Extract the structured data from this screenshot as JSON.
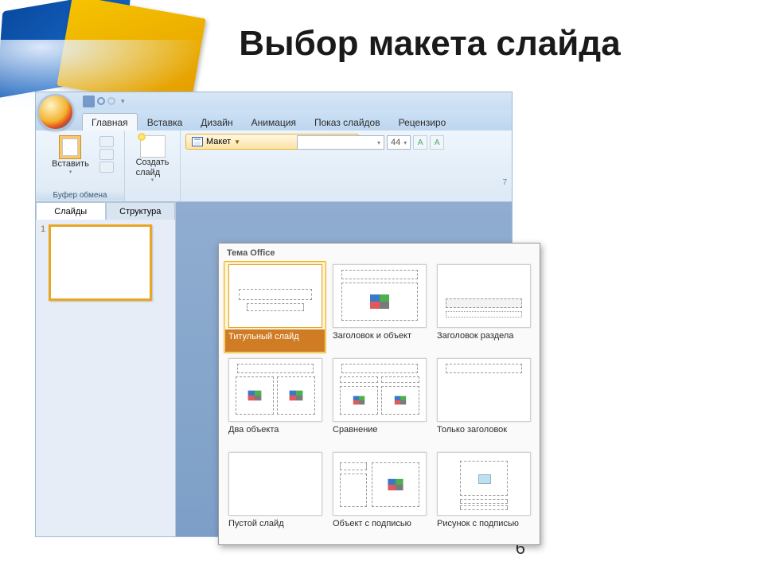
{
  "slide": {
    "title": "Выбор макета слайда",
    "page_number": "6"
  },
  "qat": {
    "save": "disk-icon",
    "undo": "undo-icon",
    "redo": "redo-icon"
  },
  "tabs": {
    "home": "Главная",
    "insert": "Вставка",
    "design": "Дизайн",
    "animation": "Анимация",
    "slideshow": "Показ слайдов",
    "review": "Рецензиро"
  },
  "ribbon": {
    "paste": "Вставить",
    "clipboard_group": "Буфер обмена",
    "new_slide": "Создать\nслайд",
    "layout_btn": "Макет",
    "font_size": "44"
  },
  "outline_tabs": {
    "slides": "Слайды",
    "outline": "Структура"
  },
  "thumb": {
    "num": "1"
  },
  "gallery": {
    "header": "Тема Office",
    "items": [
      {
        "key": "title",
        "label": "Титульный слайд"
      },
      {
        "key": "title_content",
        "label": "Заголовок и объект"
      },
      {
        "key": "section",
        "label": "Заголовок раздела"
      },
      {
        "key": "two_content",
        "label": "Два объекта"
      },
      {
        "key": "comparison",
        "label": "Сравнение"
      },
      {
        "key": "title_only",
        "label": "Только заголовок"
      },
      {
        "key": "blank",
        "label": "Пустой слайд"
      },
      {
        "key": "content_caption",
        "label": "Объект с подписью"
      },
      {
        "key": "picture_caption",
        "label": "Рисунок с подписью"
      }
    ]
  },
  "misc": {
    "seven": "7"
  }
}
